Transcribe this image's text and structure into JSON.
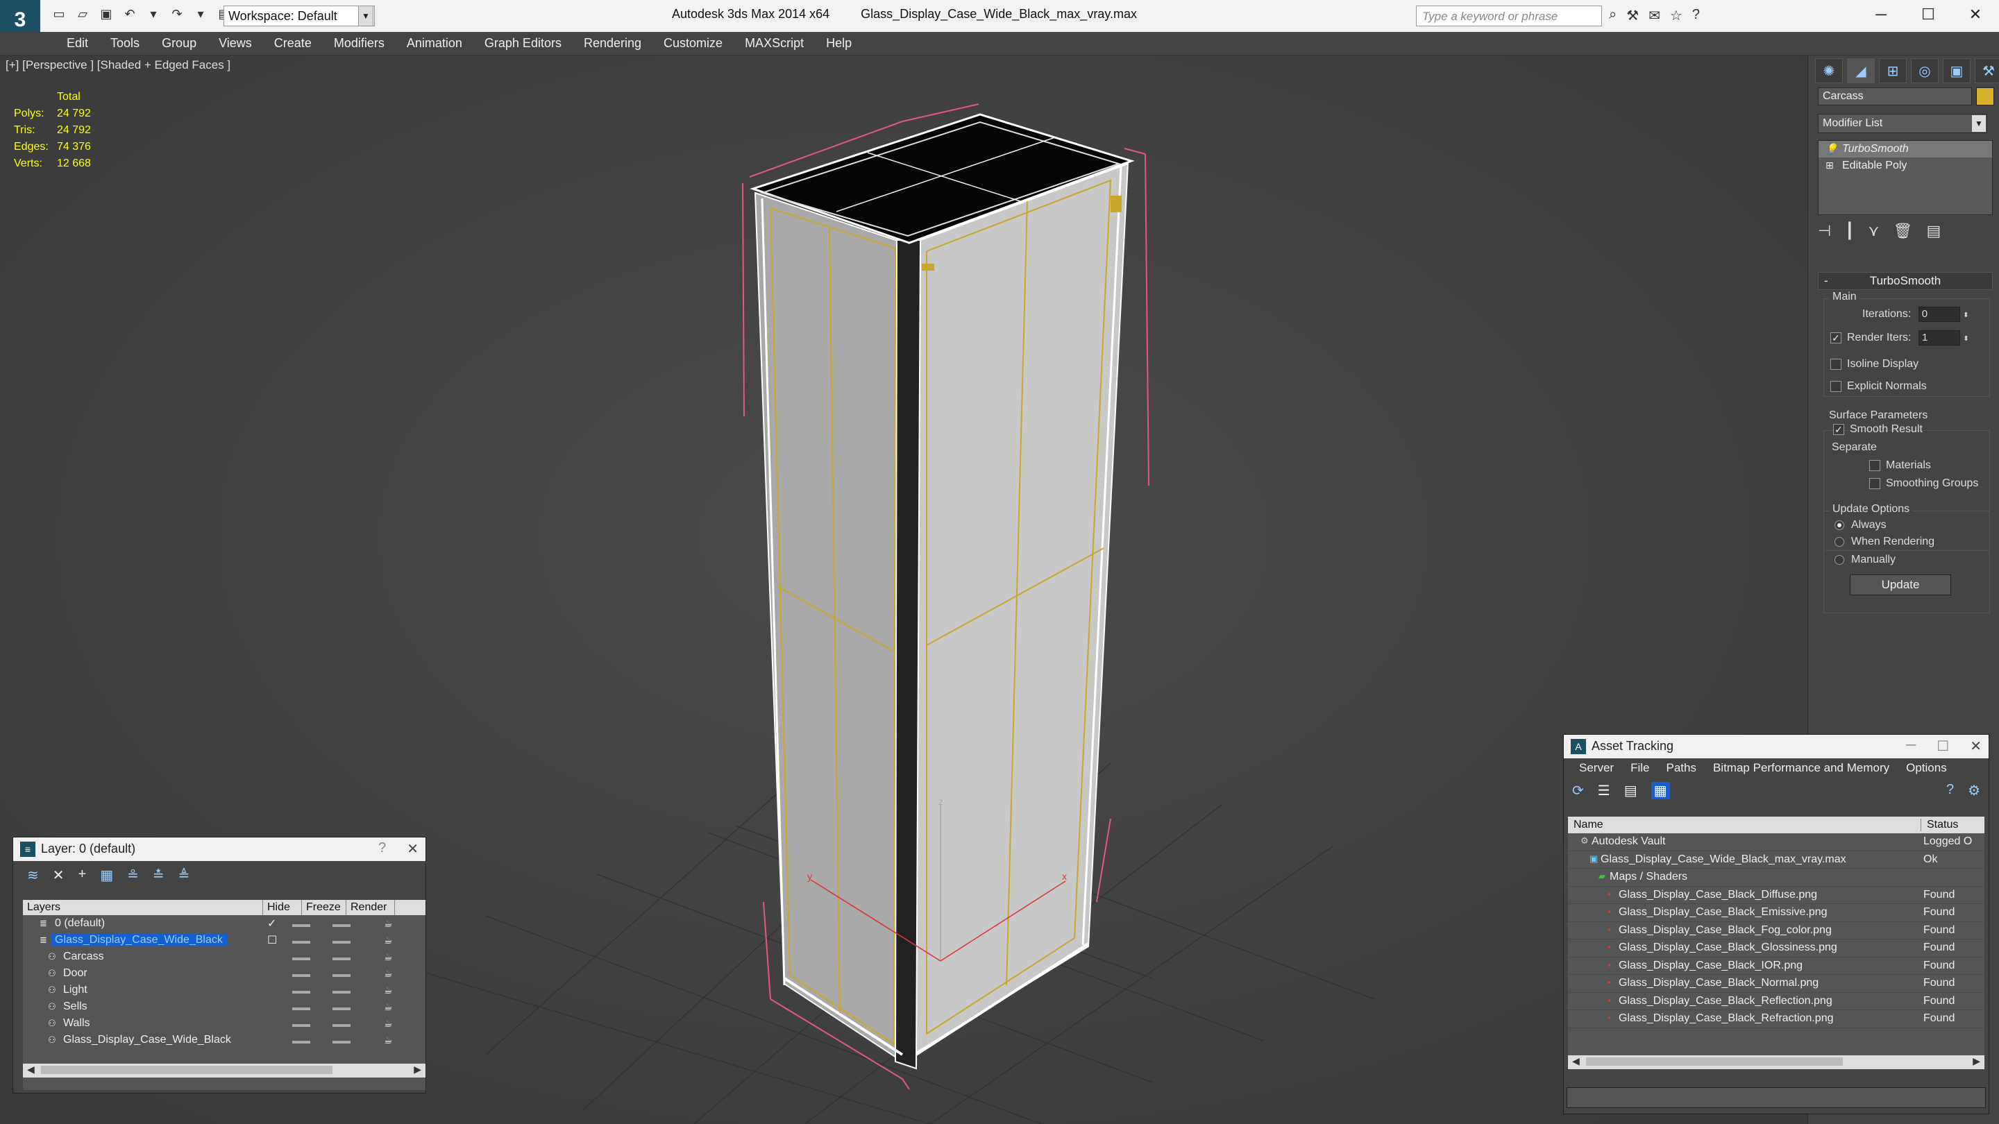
{
  "titlebar": {
    "app_title": "Autodesk 3ds Max 2014 x64",
    "file_title": "Glass_Display_Case_Wide_Black_max_vray.max",
    "workspace": "Workspace: Default",
    "search_placeholder": "Type a keyword or phrase"
  },
  "menu": [
    "Edit",
    "Tools",
    "Group",
    "Views",
    "Create",
    "Modifiers",
    "Animation",
    "Graph Editors",
    "Rendering",
    "Customize",
    "MAXScript",
    "Help"
  ],
  "viewport": {
    "label": "[+] [Perspective ] [Shaded + Edged Faces ]",
    "stats": {
      "header": "Total",
      "rows": [
        {
          "k": "Polys:",
          "v": "24 792"
        },
        {
          "k": "Tris:",
          "v": "24 792"
        },
        {
          "k": "Edges:",
          "v": "74 376"
        },
        {
          "k": "Verts:",
          "v": "12 668"
        }
      ]
    },
    "axis": {
      "z": "z",
      "y": "y",
      "x": "x"
    }
  },
  "command_panel": {
    "object_name": "Carcass",
    "object_color": "#d6b02a",
    "modifier_list": "Modifier List",
    "stack": [
      "TurboSmooth",
      "Editable Poly"
    ],
    "rollout_title": "TurboSmooth",
    "main": {
      "title": "Main",
      "iterations_label": "Iterations:",
      "iterations_value": "0",
      "render_iters_label": "Render Iters:",
      "render_iters_value": "1",
      "render_iters_checked": true,
      "isoline": "Isoline Display",
      "explicit_normals": "Explicit Normals"
    },
    "surface": {
      "title": "Surface Parameters",
      "smooth_result": "Smooth Result",
      "separate": "Separate",
      "materials": "Materials",
      "smoothing_groups": "Smoothing Groups"
    },
    "update": {
      "title": "Update Options",
      "always": "Always",
      "when_rendering": "When Rendering",
      "manually": "Manually",
      "button": "Update"
    }
  },
  "layer_window": {
    "title": "Layer: 0 (default)",
    "help": "?",
    "columns": [
      "Layers",
      "Hide",
      "Freeze",
      "Render"
    ],
    "rows": [
      {
        "name": "0 (default)",
        "indent": 0,
        "selected": false,
        "checked": true
      },
      {
        "name": "Glass_Display_Case_Wide_Black",
        "indent": 0,
        "selected": true,
        "checked": false
      },
      {
        "name": "Carcass",
        "indent": 1,
        "selected": false
      },
      {
        "name": "Door",
        "indent": 1,
        "selected": false
      },
      {
        "name": "Light",
        "indent": 1,
        "selected": false
      },
      {
        "name": "Sells",
        "indent": 1,
        "selected": false
      },
      {
        "name": "Walls",
        "indent": 1,
        "selected": false
      },
      {
        "name": "Glass_Display_Case_Wide_Black",
        "indent": 1,
        "selected": false
      }
    ]
  },
  "asset_window": {
    "title": "Asset Tracking",
    "menu": [
      "Server",
      "File",
      "Paths",
      "Bitmap Performance and Memory",
      "Options"
    ],
    "columns": [
      "Name",
      "Status"
    ],
    "rows": [
      {
        "name": "Autodesk Vault",
        "status": "Logged O",
        "indent": 0,
        "icon": "vault"
      },
      {
        "name": "Glass_Display_Case_Wide_Black_max_vray.max",
        "status": "Ok",
        "indent": 1,
        "icon": "max"
      },
      {
        "name": "Maps / Shaders",
        "status": "",
        "indent": 2,
        "icon": "maps"
      },
      {
        "name": "Glass_Display_Case_Black_Diffuse.png",
        "status": "Found",
        "indent": 3,
        "icon": "png"
      },
      {
        "name": "Glass_Display_Case_Black_Emissive.png",
        "status": "Found",
        "indent": 3,
        "icon": "png"
      },
      {
        "name": "Glass_Display_Case_Black_Fog_color.png",
        "status": "Found",
        "indent": 3,
        "icon": "png"
      },
      {
        "name": "Glass_Display_Case_Black_Glossiness.png",
        "status": "Found",
        "indent": 3,
        "icon": "png"
      },
      {
        "name": "Glass_Display_Case_Black_IOR.png",
        "status": "Found",
        "indent": 3,
        "icon": "png"
      },
      {
        "name": "Glass_Display_Case_Black_Normal.png",
        "status": "Found",
        "indent": 3,
        "icon": "png"
      },
      {
        "name": "Glass_Display_Case_Black_Reflection.png",
        "status": "Found",
        "indent": 3,
        "icon": "png"
      },
      {
        "name": "Glass_Display_Case_Black_Refraction.png",
        "status": "Found",
        "indent": 3,
        "icon": "png"
      }
    ]
  }
}
